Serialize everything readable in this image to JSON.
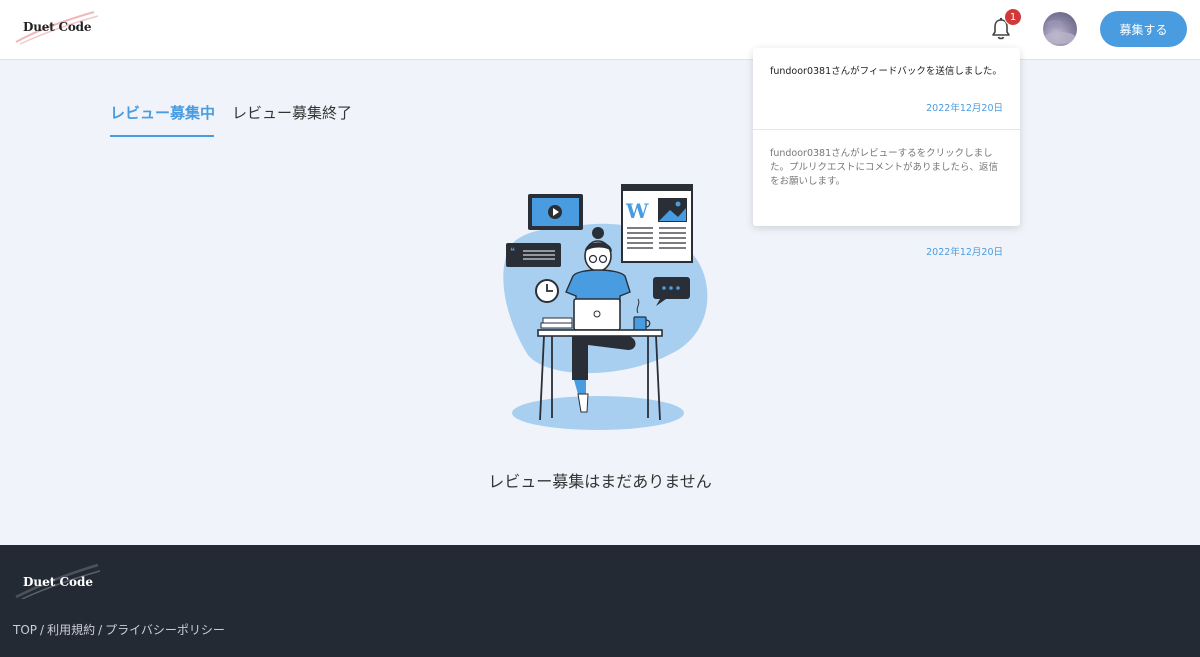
{
  "header": {
    "logo_text": "Duet Code",
    "notification_count": "1",
    "recruit_button_label": "募集する"
  },
  "tabs": [
    {
      "label": "レビュー募集中",
      "active": true
    },
    {
      "label": "レビュー募集終了",
      "active": false
    }
  ],
  "main": {
    "empty_message": "レビュー募集はまだありません"
  },
  "notifications": [
    {
      "message": "fundoor0381さんがフィードバックを送信しました。",
      "date": "2022年12月20日",
      "read": false
    },
    {
      "message": "fundoor0381さんがレビューするをクリックしました。プルリクエストにコメントがありましたら、返信をお願いします。",
      "date": "2022年12月20日",
      "read": true
    }
  ],
  "footer": {
    "logo_text": "Duet Code",
    "links": [
      {
        "label": "TOP"
      },
      {
        "label": "利用規約"
      },
      {
        "label": "プライバシーポリシー"
      }
    ]
  },
  "colors": {
    "accent": "#4a9ce0",
    "badge": "#d0393a",
    "footer_bg": "#232a34",
    "page_bg": "#f0f4fa"
  }
}
